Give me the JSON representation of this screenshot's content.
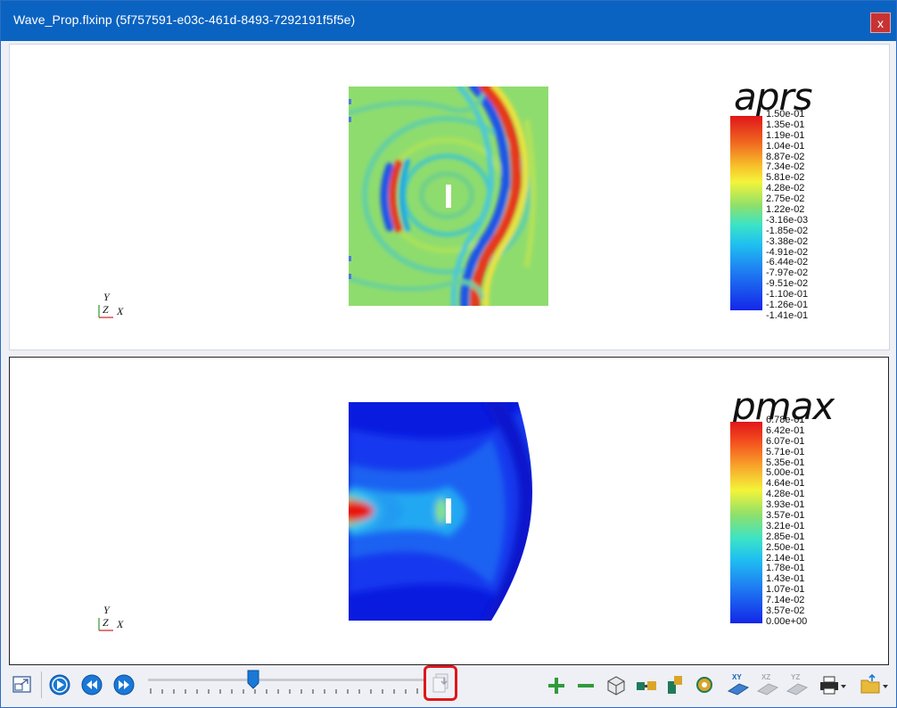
{
  "window": {
    "title": "Wave_Prop.flxinp (5f757591-e03c-461d-8493-7292191f5f5e)",
    "close_label": "x"
  },
  "views": [
    {
      "legend_title": "aprs",
      "axes": {
        "y": "Y",
        "z": "Z",
        "x": "X"
      },
      "ticks": [
        "1.50e-01",
        "1.35e-01",
        "1.19e-01",
        "1.04e-01",
        "8.87e-02",
        "7.34e-02",
        "5.81e-02",
        "4.28e-02",
        "2.75e-02",
        "1.22e-02",
        "-3.16e-03",
        "-1.85e-02",
        "-3.38e-02",
        "-4.91e-02",
        "-6.44e-02",
        "-7.97e-02",
        "-9.51e-02",
        "-1.10e-01",
        "-1.26e-01",
        "-1.41e-01"
      ]
    },
    {
      "legend_title": "pmax",
      "axes": {
        "y": "Y",
        "z": "Z",
        "x": "X"
      },
      "ticks": [
        "6.78e-01",
        "6.42e-01",
        "6.07e-01",
        "5.71e-01",
        "5.35e-01",
        "5.00e-01",
        "4.64e-01",
        "4.28e-01",
        "3.93e-01",
        "3.57e-01",
        "3.21e-01",
        "2.85e-01",
        "2.50e-01",
        "2.14e-01",
        "1.78e-01",
        "1.43e-01",
        "1.07e-01",
        "7.14e-02",
        "3.57e-02",
        "0.00e+00"
      ]
    }
  ],
  "toolbar": {
    "slider_value": 0.38,
    "highlighted_tool": "export-frame-button"
  },
  "colors": {
    "title_bar": "#0b63c1",
    "close_button": "#c83232",
    "highlight": "#e0161b",
    "play_blue": "#1a78d6",
    "zoom_green": "#2f9a3a"
  }
}
